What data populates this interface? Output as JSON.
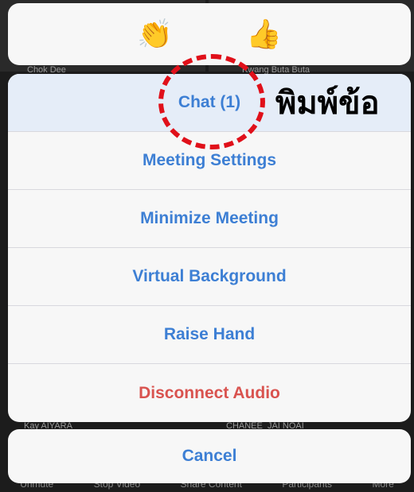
{
  "background": {
    "participants": [
      "Chok Dee",
      "Kwang Buta Buta",
      "Kay AIYARA",
      "CHANEE_JAI NOAI"
    ],
    "toolbar": [
      "Unmute",
      "Stop Video",
      "Share Content",
      "Participants",
      "More"
    ]
  },
  "reactions": [
    {
      "icon": "clapping-hands-icon",
      "glyph": "👏"
    },
    {
      "icon": "thumbs-up-icon",
      "glyph": "👍"
    }
  ],
  "menu": {
    "items": [
      {
        "label": "Chat (1)",
        "highlighted": true
      },
      {
        "label": "Meeting Settings"
      },
      {
        "label": "Minimize Meeting"
      },
      {
        "label": "Virtual Background"
      },
      {
        "label": "Raise Hand"
      },
      {
        "label": "Disconnect Audio",
        "destructive": true
      }
    ],
    "cancel_label": "Cancel"
  },
  "annotation": {
    "text": "พิมพ์ข้อ",
    "ring_color": "#e0101a"
  },
  "colors": {
    "accent": "#3d7fd4",
    "destructive": "#d9534f",
    "sheet": "#f7f7f7"
  }
}
